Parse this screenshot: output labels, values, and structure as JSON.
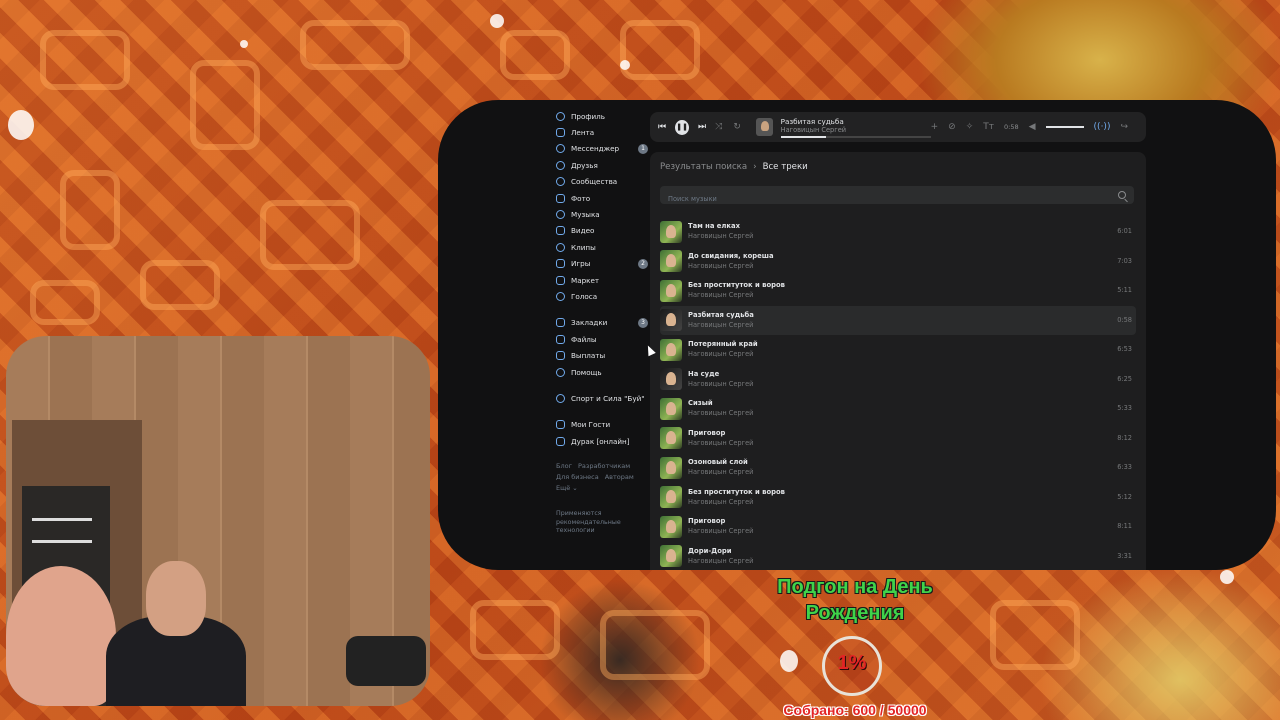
{
  "sidebar": {
    "items": [
      {
        "label": "Профиль",
        "icon": "user-icon"
      },
      {
        "label": "Лента",
        "icon": "feed-icon"
      },
      {
        "label": "Мессенджер",
        "icon": "chat-icon",
        "badge": "1"
      },
      {
        "label": "Друзья",
        "icon": "friends-icon"
      },
      {
        "label": "Сообщества",
        "icon": "groups-icon"
      },
      {
        "label": "Фото",
        "icon": "photo-icon"
      },
      {
        "label": "Музыка",
        "icon": "music-icon"
      },
      {
        "label": "Видео",
        "icon": "video-icon"
      },
      {
        "label": "Клипы",
        "icon": "clips-icon"
      },
      {
        "label": "Игры",
        "icon": "games-icon",
        "badge": "2"
      },
      {
        "label": "Маркет",
        "icon": "market-icon"
      },
      {
        "label": "Голоса",
        "icon": "votes-icon"
      }
    ],
    "items2": [
      {
        "label": "Закладки",
        "icon": "bookmark-icon",
        "badge": "3"
      },
      {
        "label": "Файлы",
        "icon": "file-icon"
      },
      {
        "label": "Выплаты",
        "icon": "payout-icon"
      },
      {
        "label": "Помощь",
        "icon": "help-icon"
      }
    ],
    "group": "Спорт и Сила \"Буй\"",
    "apps": [
      "Мои Гости",
      "Дурак [онлайн]"
    ],
    "footer": {
      "blog": "Блог",
      "devs": "Разработчикам",
      "business": "Для бизнеса",
      "authors": "Авторам",
      "more": "Ещё ⌄"
    },
    "rec_note": "Применяются рекомендательные технологии"
  },
  "player": {
    "title": "Разбитая судьба",
    "artist": "Наговицын Сергей",
    "time": "0:58",
    "progress": 0.3
  },
  "breadcrumb": {
    "parent": "Результаты поиска",
    "current": "Все треки"
  },
  "search": {
    "placeholder": "Поиск музыки"
  },
  "tracks": [
    {
      "title": "Там на елках",
      "artist": "Наговицын Сергей",
      "duration": "6:01"
    },
    {
      "title": "До свидания, кореша",
      "artist": "Наговицын Сергей",
      "duration": "7:03"
    },
    {
      "title": "Без проституток и воров",
      "artist": "Наговицын Сергей",
      "duration": "5:11"
    },
    {
      "title": "Разбитая судьба",
      "artist": "Наговицын Сергей",
      "duration": "0:58"
    },
    {
      "title": "Потерянный край",
      "artist": "Наговицын Сергей",
      "duration": "6:53"
    },
    {
      "title": "На суде",
      "artist": "Наговицын Сергей",
      "duration": "6:25"
    },
    {
      "title": "Сизый",
      "artist": "Наговицын Сергей",
      "duration": "5:33"
    },
    {
      "title": "Приговор",
      "artist": "Наговицын Сергей",
      "duration": "8:12"
    },
    {
      "title": "Озоновый слой",
      "artist": "Наговицын Сергей",
      "duration": "6:33"
    },
    {
      "title": "Без проституток и воров",
      "artist": "Наговицын Сергей",
      "duration": "5:12"
    },
    {
      "title": "Приговор",
      "artist": "Наговицын Сергей",
      "duration": "8:11"
    },
    {
      "title": "Дори-Дори",
      "artist": "Наговицын Сергей",
      "duration": "3:31"
    }
  ],
  "goal": {
    "title": "Подгон на День Рождения",
    "percent": "1%",
    "collected": "Собрано: 600 / 50000"
  },
  "colors": {
    "accent": "#71aaeb",
    "goal_title": "#3fd34a",
    "goal_red": "#e32424"
  }
}
